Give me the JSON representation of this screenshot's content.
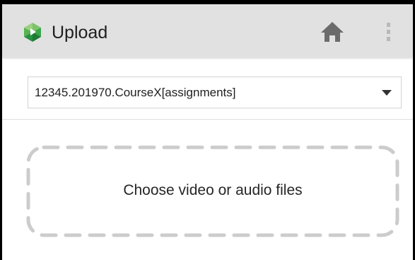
{
  "app_bar": {
    "title": "Upload",
    "logo_icon": "panopto-logo-icon",
    "logo_colors": [
      "#1e7b34",
      "#3aa64a",
      "#7cc36a"
    ],
    "home_icon": "home-icon",
    "more_icon": "more-vertical-icon"
  },
  "folder_select": {
    "selected_value": "12345.201970.CourseX[assignments]",
    "dropdown_icon": "dropdown-arrow-icon"
  },
  "drop_zone": {
    "label": "Choose video or audio files",
    "border_color": "#cccccc"
  },
  "colors": {
    "app_bar_bg": "#e1e1e1",
    "home_icon": "#6b6b6b",
    "more_icon": "#b9b9b9"
  }
}
